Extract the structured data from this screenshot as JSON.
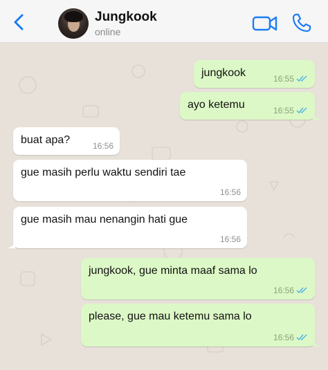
{
  "header": {
    "contact_name": "Jungkook",
    "contact_status": "online",
    "icons": [
      "chevron-left-icon",
      "avatar",
      "video-icon",
      "phone-icon"
    ],
    "accent_color": "#1a7cf5"
  },
  "messages": [
    {
      "direction": "out",
      "text": "jungkook",
      "time": "16:55",
      "read": true
    },
    {
      "direction": "out",
      "text": "ayo ketemu",
      "time": "16:55",
      "read": true
    },
    {
      "direction": "in",
      "text": "buat apa?",
      "time": "16:56"
    },
    {
      "direction": "in",
      "text": "gue masih perlu waktu sendiri tae",
      "time": "16:56"
    },
    {
      "direction": "in",
      "text": "gue masih mau nenangin hati gue",
      "time": "16:56"
    },
    {
      "direction": "out",
      "text": "jungkook, gue minta maaf sama lo",
      "time": "16:56",
      "read": true
    },
    {
      "direction": "out",
      "text": "please, gue mau ketemu sama lo",
      "time": "16:56",
      "read": true
    }
  ],
  "colors": {
    "outgoing_bubble": "#dcf8c6",
    "incoming_bubble": "#ffffff",
    "chat_background": "#e7e1d9",
    "read_ticks": "#4fb3e8"
  }
}
